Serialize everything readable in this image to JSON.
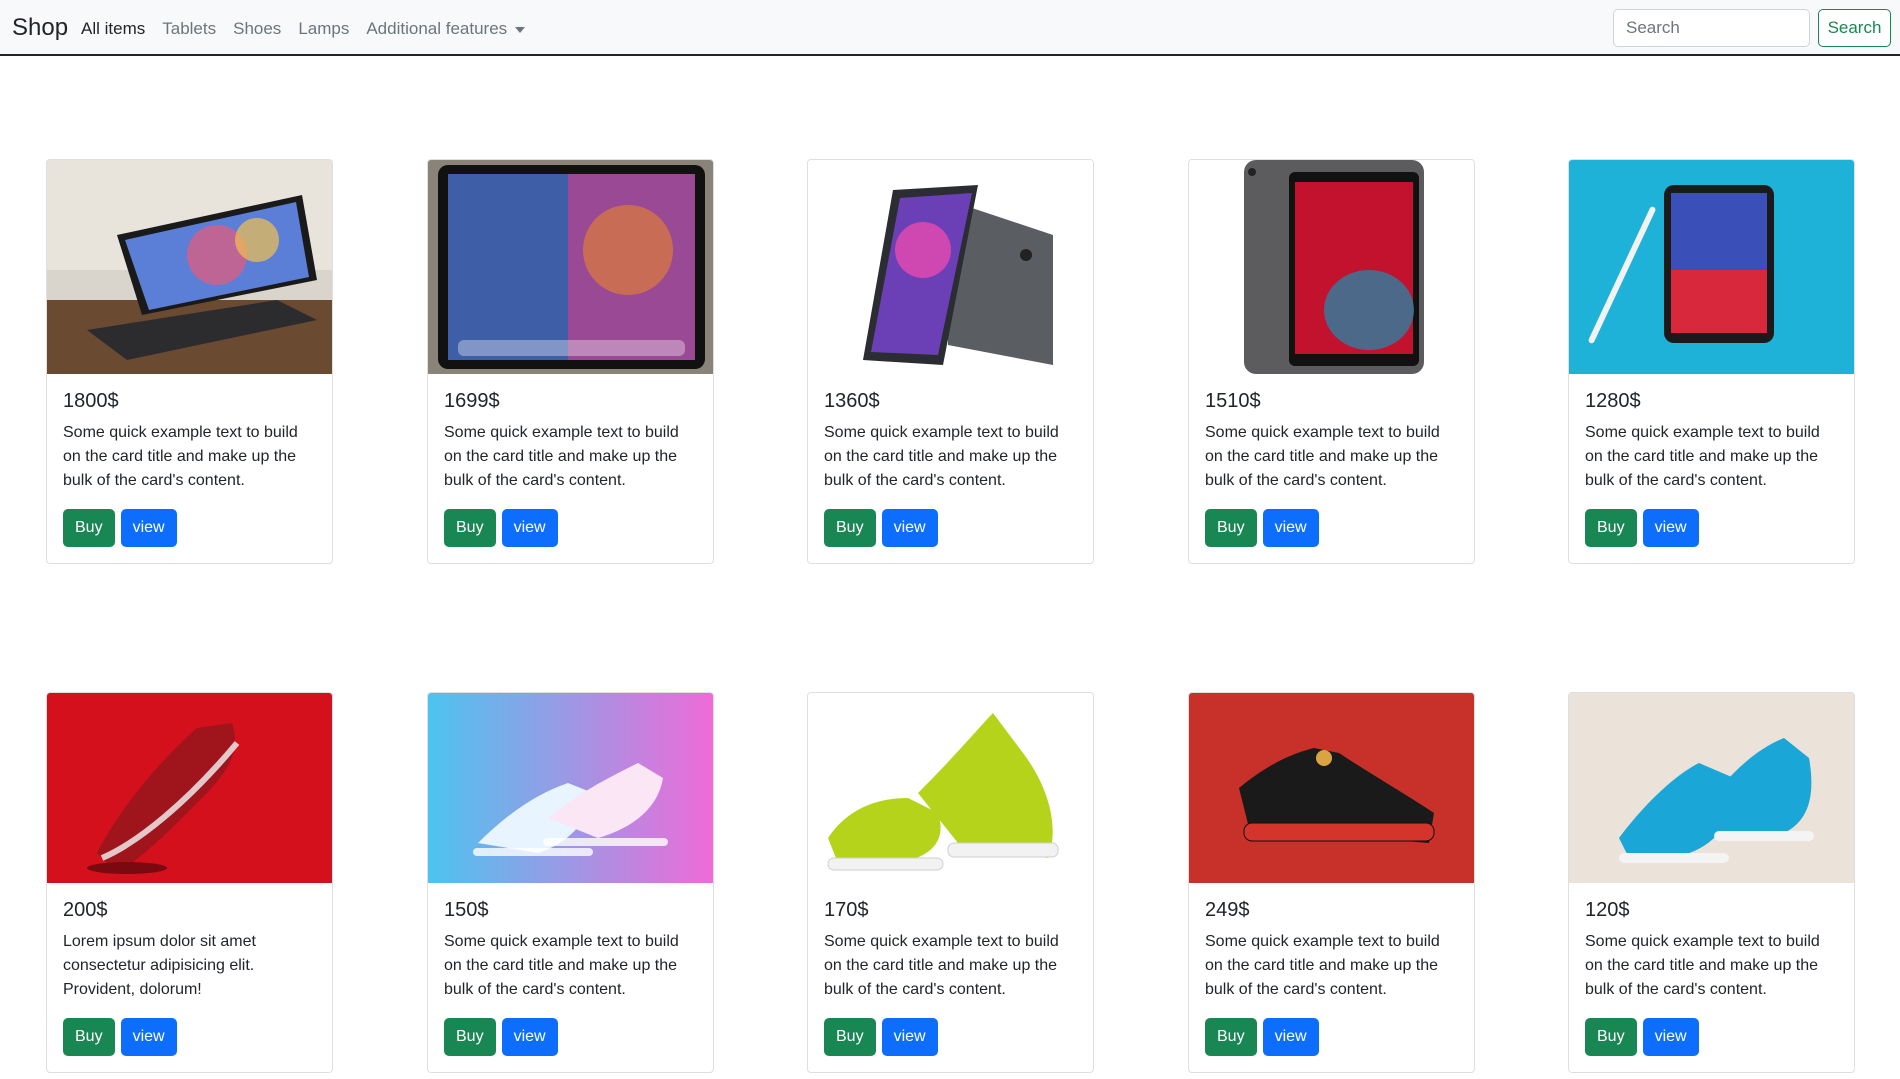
{
  "navbar": {
    "brand": "Shop",
    "links": [
      "All items",
      "Tablets",
      "Shoes",
      "Lamps",
      "Additional features"
    ],
    "search_placeholder": "Search",
    "search_button": "Search"
  },
  "colors": {
    "buy": "#198754",
    "view": "#0d6efd",
    "search_outline": "#198754"
  },
  "buttons": {
    "buy": "Buy",
    "view": "view"
  },
  "products": [
    {
      "price": "1800$",
      "desc": "Some quick example text to build on the card title and make up the bulk of the card's content.",
      "image": "tablet-keyboard-image"
    },
    {
      "price": "1699$",
      "desc": "Some quick example text to build on the card title and make up the bulk of the card's content.",
      "image": "tablet-screen-image"
    },
    {
      "price": "1360$",
      "desc": "Some quick example text to build on the card title and make up the bulk of the card's content.",
      "image": "tablet-side-image"
    },
    {
      "price": "1510$",
      "desc": "Some quick example text to build on the card title and make up the bulk of the card's content.",
      "image": "tablet-front-image"
    },
    {
      "price": "1280$",
      "desc": "Some quick example text to build on the card title and make up the bulk of the card's content.",
      "image": "tablet-pencil-image"
    },
    {
      "price": "200$",
      "desc": "Lorem ipsum dolor sit amet consectetur adipisicing elit. Provident, dolorum!",
      "image": "red-sneaker-image"
    },
    {
      "price": "150$",
      "desc": "Some quick example text to build on the card title and make up the bulk of the card's content.",
      "image": "neon-sneakers-image"
    },
    {
      "price": "170$",
      "desc": "Some quick example text to build on the card title and make up the bulk of the card's content.",
      "image": "lime-sneakers-image"
    },
    {
      "price": "249$",
      "desc": "Some quick example text to build on the card title and make up the bulk of the card's content.",
      "image": "black-sneaker-image"
    },
    {
      "price": "120$",
      "desc": "Some quick example text to build on the card title and make up the bulk of the card's content.",
      "image": "blue-sneakers-image"
    }
  ]
}
